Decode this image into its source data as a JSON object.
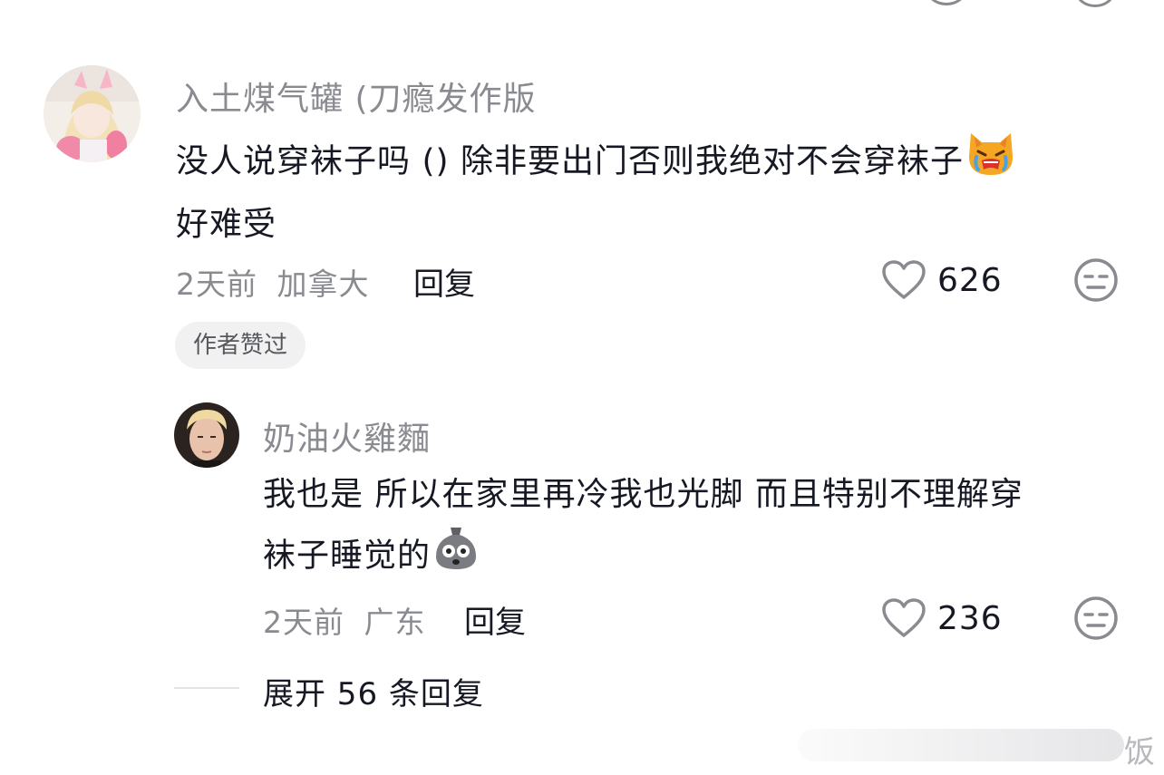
{
  "comment_main": {
    "username": "入土煤气罐 (刀瘾发作版",
    "text_line1": "没人说穿袜子吗 () 除非要出门否则我绝对不会穿袜子",
    "text_line2": "好难受",
    "emoji": "crying-cat-emoji",
    "time": "2天前",
    "location": "加拿大",
    "reply_label": "回复",
    "likes": "626",
    "author_liked": "作者赞过"
  },
  "comment_reply": {
    "username": "奶油火雞麵",
    "text_line1": "我也是 所以在家里再冷我也光脚 而且特别不理解穿",
    "text_line2": "袜子睡觉的",
    "emoji": "shocked-bag-emoji",
    "time": "2天前",
    "location": "广东",
    "reply_label": "回复",
    "likes": "236"
  },
  "expand_replies": "展开 56 条回复",
  "watermark": "饭",
  "colors": {
    "primary_text": "#161823",
    "secondary_text": "#8a8b91",
    "badge_bg": "#f1f1f2",
    "divider": "#e3e3e4"
  }
}
